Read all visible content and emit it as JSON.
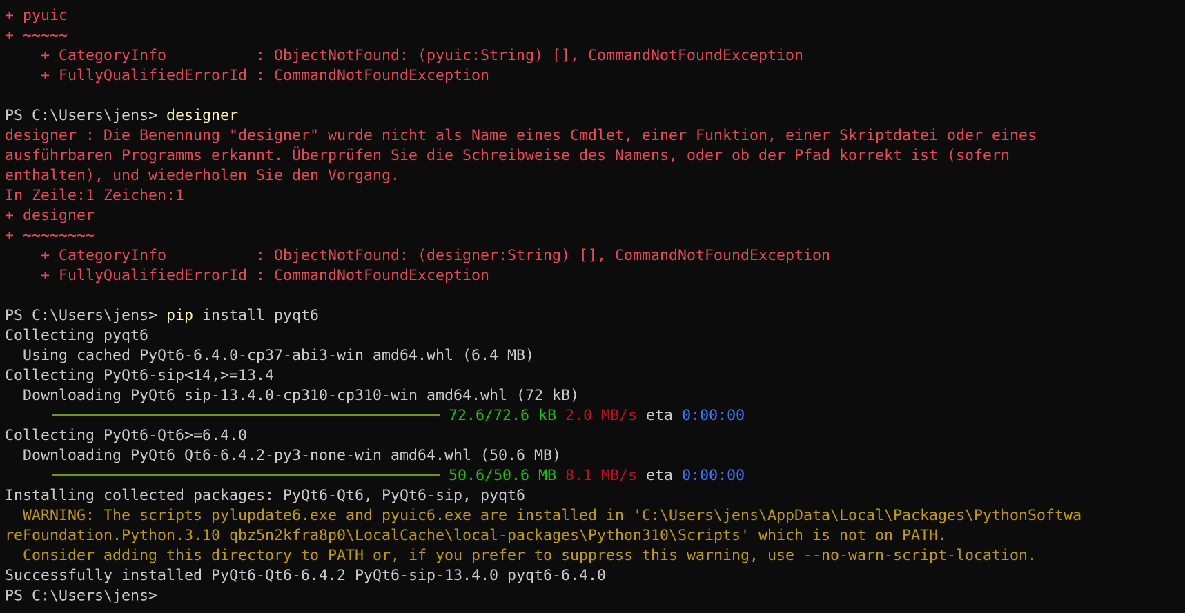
{
  "colors": {
    "background": "#0c0c0c",
    "default": "#cccccc",
    "error": "#e74856",
    "command": "#f9f1a5",
    "warning": "#c19c00",
    "progress": "#6c9a0e",
    "speed_red": "#c50f1f",
    "eta_blue": "#3b78ff",
    "size_green": "#16c60c"
  },
  "lines": [
    {
      "type": "text",
      "spans": [
        {
          "c": "error",
          "t": "+ pyuic"
        }
      ]
    },
    {
      "type": "text",
      "spans": [
        {
          "c": "error",
          "t": "+ ~~~~~"
        }
      ]
    },
    {
      "type": "text",
      "spans": [
        {
          "c": "error",
          "t": "    + CategoryInfo          : ObjectNotFound: (pyuic:String) [], CommandNotFoundException"
        }
      ]
    },
    {
      "type": "text",
      "spans": [
        {
          "c": "error",
          "t": "    + FullyQualifiedErrorId : CommandNotFoundException"
        }
      ]
    },
    {
      "type": "text",
      "spans": []
    },
    {
      "type": "text",
      "spans": [
        {
          "c": "default",
          "t": "PS C:\\Users\\jens> "
        },
        {
          "c": "cmd",
          "t": "designer"
        }
      ]
    },
    {
      "type": "text",
      "spans": [
        {
          "c": "error",
          "t": "designer : Die Benennung \"designer\" wurde nicht als Name eines Cmdlet, einer Funktion, einer Skriptdatei oder eines"
        }
      ]
    },
    {
      "type": "text",
      "spans": [
        {
          "c": "error",
          "t": "ausführbaren Programms erkannt. Überprüfen Sie die Schreibweise des Namens, oder ob der Pfad korrekt ist (sofern"
        }
      ]
    },
    {
      "type": "text",
      "spans": [
        {
          "c": "error",
          "t": "enthalten), und wiederholen Sie den Vorgang."
        }
      ]
    },
    {
      "type": "text",
      "spans": [
        {
          "c": "error",
          "t": "In Zeile:1 Zeichen:1"
        }
      ]
    },
    {
      "type": "text",
      "spans": [
        {
          "c": "error",
          "t": "+ designer"
        }
      ]
    },
    {
      "type": "text",
      "spans": [
        {
          "c": "error",
          "t": "+ ~~~~~~~~"
        }
      ]
    },
    {
      "type": "text",
      "spans": [
        {
          "c": "error",
          "t": "    + CategoryInfo          : ObjectNotFound: (designer:String) [], CommandNotFoundException"
        }
      ]
    },
    {
      "type": "text",
      "spans": [
        {
          "c": "error",
          "t": "    + FullyQualifiedErrorId : CommandNotFoundException"
        }
      ]
    },
    {
      "type": "text",
      "spans": []
    },
    {
      "type": "text",
      "spans": [
        {
          "c": "default",
          "t": "PS C:\\Users\\jens> "
        },
        {
          "c": "cmd",
          "t": "pip"
        },
        {
          "c": "default",
          "t": " install pyqt6"
        }
      ]
    },
    {
      "type": "text",
      "spans": [
        {
          "c": "default",
          "t": "Collecting pyqt6"
        }
      ]
    },
    {
      "type": "text",
      "spans": [
        {
          "c": "default",
          "t": "  Using cached PyQt6-6.4.0-cp37-abi3-win_amd64.whl (6.4 MB)"
        }
      ]
    },
    {
      "type": "text",
      "spans": [
        {
          "c": "default",
          "t": "Collecting PyQt6-sip<14,>=13.4"
        }
      ]
    },
    {
      "type": "text",
      "spans": [
        {
          "c": "default",
          "t": "  Downloading PyQt6_sip-13.4.0-cp310-cp310-win_amd64.whl (72 kB)"
        }
      ]
    },
    {
      "type": "progress",
      "progress": 1.0,
      "spans": [
        {
          "c": "green",
          "t": "72.6/72.6 kB"
        },
        {
          "c": "default",
          "t": " "
        },
        {
          "c": "red",
          "t": "2.0 MB/s"
        },
        {
          "c": "default",
          "t": " eta "
        },
        {
          "c": "blue",
          "t": "0:00:00"
        }
      ]
    },
    {
      "type": "text",
      "spans": [
        {
          "c": "default",
          "t": "Collecting PyQt6-Qt6>=6.4.0"
        }
      ]
    },
    {
      "type": "text",
      "spans": [
        {
          "c": "default",
          "t": "  Downloading PyQt6_Qt6-6.4.2-py3-none-win_amd64.whl (50.6 MB)"
        }
      ]
    },
    {
      "type": "progress",
      "progress": 1.0,
      "spans": [
        {
          "c": "green",
          "t": "50.6/50.6 MB"
        },
        {
          "c": "default",
          "t": " "
        },
        {
          "c": "red",
          "t": "8.1 MB/s"
        },
        {
          "c": "default",
          "t": " eta "
        },
        {
          "c": "blue",
          "t": "0:00:00"
        }
      ]
    },
    {
      "type": "text",
      "spans": [
        {
          "c": "default",
          "t": "Installing collected packages: PyQt6-Qt6, PyQt6-sip, pyqt6"
        }
      ]
    },
    {
      "type": "text",
      "spans": [
        {
          "c": "warn",
          "t": "  WARNING: The scripts pylupdate6.exe and pyuic6.exe are installed in 'C:\\Users\\jens\\AppData\\Local\\Packages\\PythonSoftwa"
        }
      ]
    },
    {
      "type": "text",
      "spans": [
        {
          "c": "warn",
          "t": "reFoundation.Python.3.10_qbz5n2kfra8p0\\LocalCache\\local-packages\\Python310\\Scripts' which is not on PATH."
        }
      ]
    },
    {
      "type": "text",
      "spans": [
        {
          "c": "warn",
          "t": "  Consider adding this directory to PATH or, if you prefer to suppress this warning, use --no-warn-script-location."
        }
      ]
    },
    {
      "type": "text",
      "spans": [
        {
          "c": "default",
          "t": "Successfully installed PyQt6-Qt6-6.4.2 PyQt6-sip-13.4.0 pyqt6-6.4.0"
        }
      ]
    },
    {
      "type": "prompt",
      "spans": [
        {
          "c": "default",
          "t": "PS C:\\Users\\jens> "
        }
      ]
    }
  ]
}
